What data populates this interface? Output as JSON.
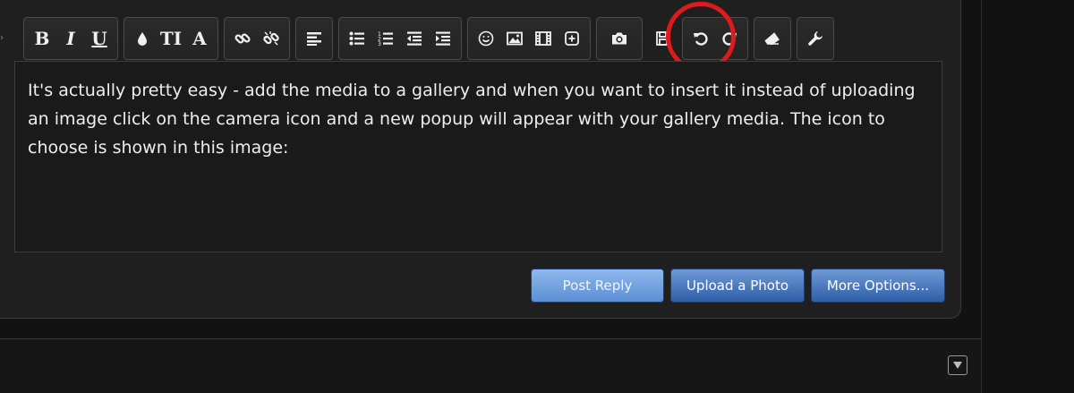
{
  "toolbar": {
    "bold_label": "B",
    "italic_label": "I",
    "underline_label": "U",
    "text_size_label": "TI",
    "font_label": "A"
  },
  "editor": {
    "content": "It's actually pretty easy - add the media to a gallery and when you want to insert it instead of uploading an image click on the camera icon and a new popup will appear with your gallery media. The icon to choose is shown in this image:"
  },
  "buttons": {
    "post_reply": "Post Reply",
    "upload_photo": "Upload a Photo",
    "more_options": "More Options..."
  },
  "colors": {
    "highlight_ring": "#e01a1a",
    "button_blue": "#2f5ea8",
    "button_light": "#8fb8ee"
  },
  "icons": [
    "bold-icon",
    "italic-icon",
    "underline-icon",
    "color-drop-icon",
    "text-size-icon",
    "font-icon",
    "link-icon",
    "unlink-icon",
    "align-icon",
    "bullet-list-icon",
    "numbered-list-icon",
    "outdent-icon",
    "indent-icon",
    "smiley-icon",
    "image-icon",
    "media-icon",
    "insert-icon",
    "camera-icon",
    "save-icon",
    "undo-icon",
    "redo-icon",
    "eraser-icon",
    "wrench-icon",
    "collapse-icon"
  ]
}
